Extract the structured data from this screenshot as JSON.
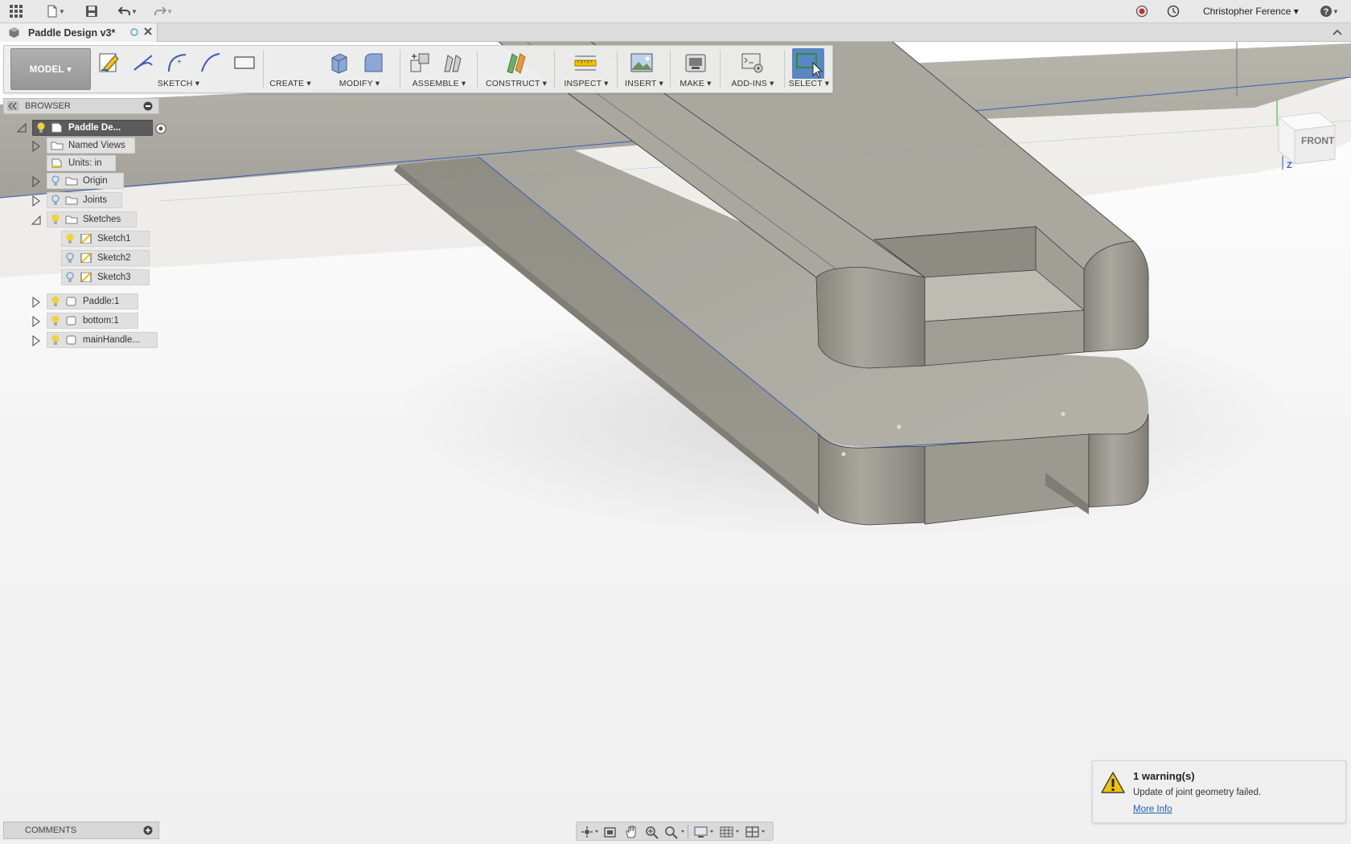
{
  "app": {
    "user_name": "Christopher Ference ▾"
  },
  "document": {
    "tab_title": "Paddle Design v3*"
  },
  "toolbar": {
    "workspace_label": "MODEL ▾",
    "groups": {
      "sketch": "SKETCH ▾",
      "create": "CREATE ▾",
      "modify": "MODIFY ▾",
      "assemble": "ASSEMBLE ▾",
      "construct": "CONSTRUCT ▾",
      "inspect": "INSPECT ▾",
      "insert": "INSERT ▾",
      "make": "MAKE ▾",
      "addins": "ADD-INS ▾",
      "select": "SELECT ▾"
    }
  },
  "browser": {
    "header": "BROWSER",
    "root": "Paddle De...",
    "named_views": "Named Views",
    "units": "Units: in",
    "origin": "Origin",
    "joints": "Joints",
    "sketches": "Sketches",
    "sketch1": "Sketch1",
    "sketch2": "Sketch2",
    "sketch3": "Sketch3",
    "body1": "Paddle:1",
    "body2": "bottom:1",
    "body3": "mainHandle..."
  },
  "comments": {
    "label": "COMMENTS"
  },
  "viewcube": {
    "face_label": "FRONT",
    "axis_z": "Z"
  },
  "warning": {
    "title": "1 warning(s)",
    "message": "Update of joint geometry failed.",
    "link": "More Info"
  },
  "colors": {
    "accent_blue": "#4a7fc1",
    "model_gray": "#a8a79f",
    "warning_yellow": "#f2c300"
  }
}
